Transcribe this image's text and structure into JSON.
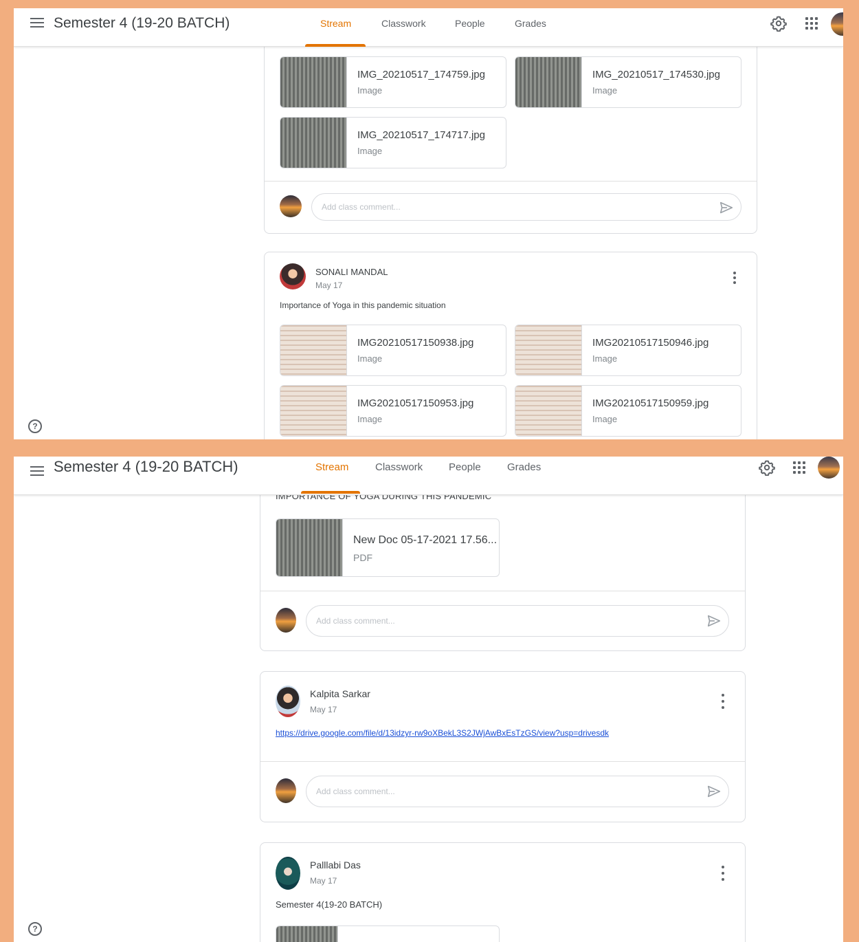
{
  "app": {
    "title": "Semester 4 (19-20 BATCH)",
    "tabs": [
      "Stream",
      "Classwork",
      "People",
      "Grades"
    ],
    "active_tab": "Stream"
  },
  "colors": {
    "accent": "#e37400",
    "frame_background": "#f2ae7f",
    "link": "#1a4fd6"
  },
  "icons": [
    "menu-icon",
    "gear-icon",
    "apps-icon",
    "avatar",
    "help-icon",
    "send-icon",
    "more-vert-icon"
  ],
  "comment": {
    "placeholder": "Add class comment..."
  },
  "panel1": {
    "post_a_attachments": [
      {
        "name": "IMG_20210517_174759.jpg",
        "type": "Image"
      },
      {
        "name": "IMG_20210517_174530.jpg",
        "type": "Image"
      },
      {
        "name": "IMG_20210517_174717.jpg",
        "type": "Image"
      }
    ],
    "post_b": {
      "author": "SONALI MANDAL",
      "date": "May 17",
      "text": "Importance of Yoga in this pandemic situation",
      "attachments": [
        {
          "name": "IMG20210517150938.jpg",
          "type": "Image"
        },
        {
          "name": "IMG20210517150946.jpg",
          "type": "Image"
        },
        {
          "name": "IMG20210517150953.jpg",
          "type": "Image"
        },
        {
          "name": "IMG20210517150959.jpg",
          "type": "Image"
        }
      ]
    }
  },
  "panel2": {
    "post_a": {
      "text": "IMPORTANCE OF YOGA DURING THIS PANDEMIC",
      "attachment": {
        "name": "New Doc 05-17-2021 17.56...",
        "type": "PDF"
      }
    },
    "post_b": {
      "author": "Kalpita Sarkar",
      "date": "May 17",
      "link": "https://drive.google.com/file/d/13idzyr-rw9oXBekL3S2JWjAwBxEsTzGS/view?usp=drivesdk"
    },
    "post_c": {
      "author": "Palllabi Das",
      "date": "May 17",
      "text": "Semester 4(19-20 BATCH)"
    }
  }
}
